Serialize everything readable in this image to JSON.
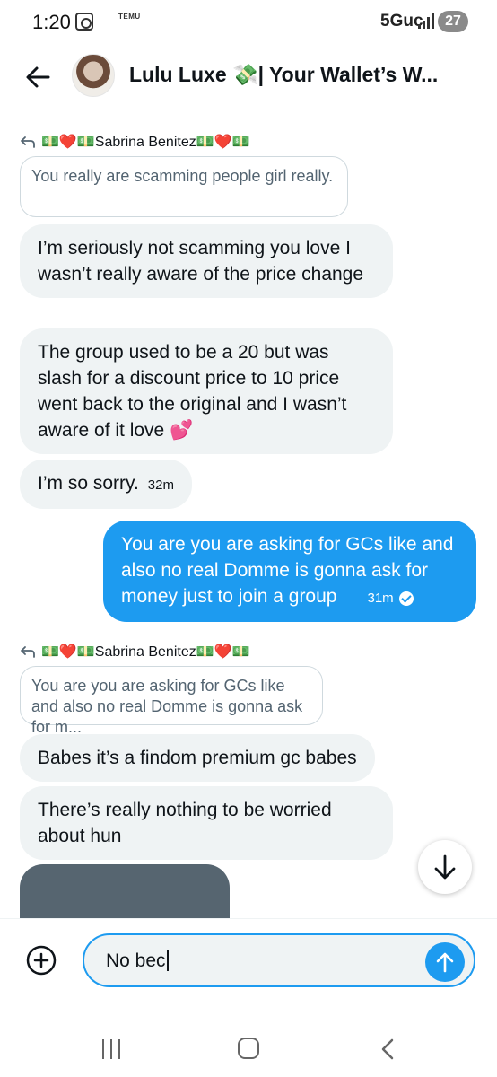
{
  "status_bar": {
    "time": "1:20",
    "app_badge": "TEMU",
    "network": "5Guc",
    "battery": "27"
  },
  "header": {
    "title": "Lulu Luxe 💸| Your Wallet’s W..."
  },
  "conversation": {
    "reply_author": "💵❤️💵Sabrina Benitez💵❤️💵",
    "quote_1": "You really are scamming people girl really.",
    "msg_1": "I’m seriously not scamming you love I wasn’t really aware of the price change",
    "msg_2": "The group used to be a 20  but was slash for a discount price to 10 price went back to the original and I wasn’t aware of it love 💕",
    "msg_3": "I’m so sorry.",
    "msg_3_time": "32m",
    "out_1": "You are you are asking for GCs like and also no real Domme is gonna ask for money just to join a group",
    "out_1_time": "31m",
    "quote_2": "You are you are asking for GCs like and also no real Domme is gonna ask for m...",
    "msg_4": "Babes it’s a findom premium gc babes",
    "msg_5": "There’s really nothing to be worried about hun"
  },
  "composer": {
    "value": "No bec"
  },
  "colors": {
    "accent": "#1d9bf0",
    "bubble_in": "#eff3f4",
    "text": "#0f1419",
    "muted": "#536471"
  },
  "icons": {
    "back": "arrow-left-icon",
    "add": "plus-circle-icon",
    "send": "arrow-up-icon",
    "scroll": "arrow-down-icon",
    "reply": "reply-arrow-icon"
  }
}
